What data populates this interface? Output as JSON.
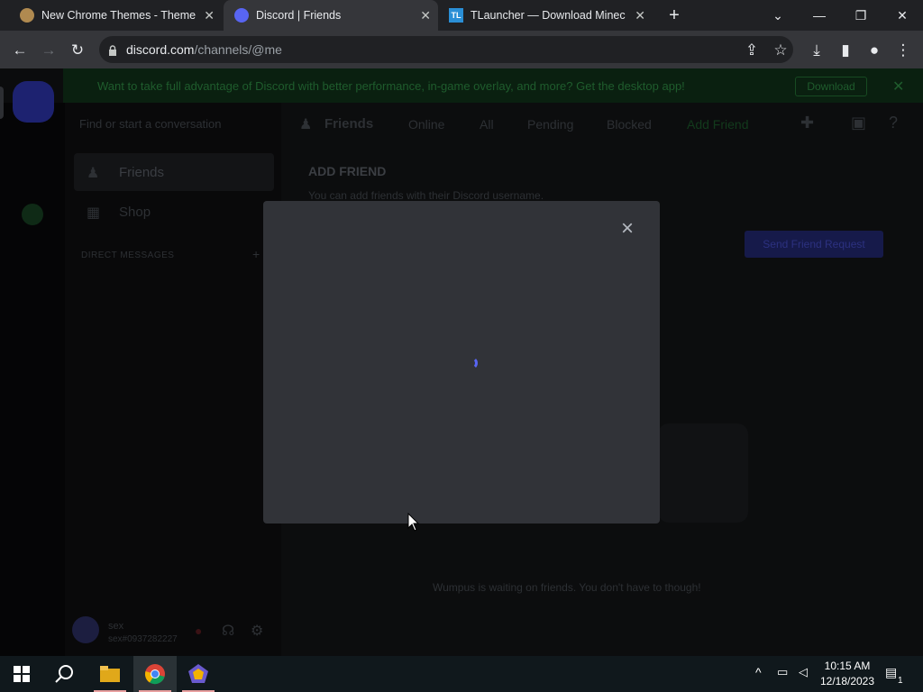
{
  "browser": {
    "tabs": [
      {
        "label": "New Chrome Themes - ThemeBeta",
        "icon": "themebeta-icon",
        "active": false
      },
      {
        "label": "Discord | Friends",
        "icon": "discord-icon",
        "active": true
      },
      {
        "label": "TLauncher — Download Minecraft",
        "icon": "tlauncher-icon",
        "active": false
      }
    ],
    "url_host": "discord.com",
    "url_path": "/channels/@me"
  },
  "discord": {
    "banner_text": "Want to take full advantage of Discord with better performance, in-game overlay, and more? Get the desktop app!",
    "banner_button": "Download",
    "search_placeholder": "Find or start a conversation",
    "nav": {
      "friends": "Friends",
      "shop": "Shop",
      "direct_messages": "DIRECT MESSAGES"
    },
    "header": {
      "title": "Friends",
      "tabs": [
        "Online",
        "All",
        "Pending",
        "Blocked",
        "Add Friend"
      ]
    },
    "add_friend": {
      "heading": "ADD FRIEND",
      "subtext": "You can add friends with their Discord username.",
      "button": "Send Friend Request",
      "empty_text": "Wumpus is waiting on friends. You don't have to though!"
    },
    "user": {
      "name": "sex",
      "tag": "sex#0937282227"
    }
  },
  "modal": {
    "close_label": "×"
  },
  "taskbar": {
    "time": "10:15 AM",
    "date": "12/18/2023",
    "notification_count": "1"
  }
}
